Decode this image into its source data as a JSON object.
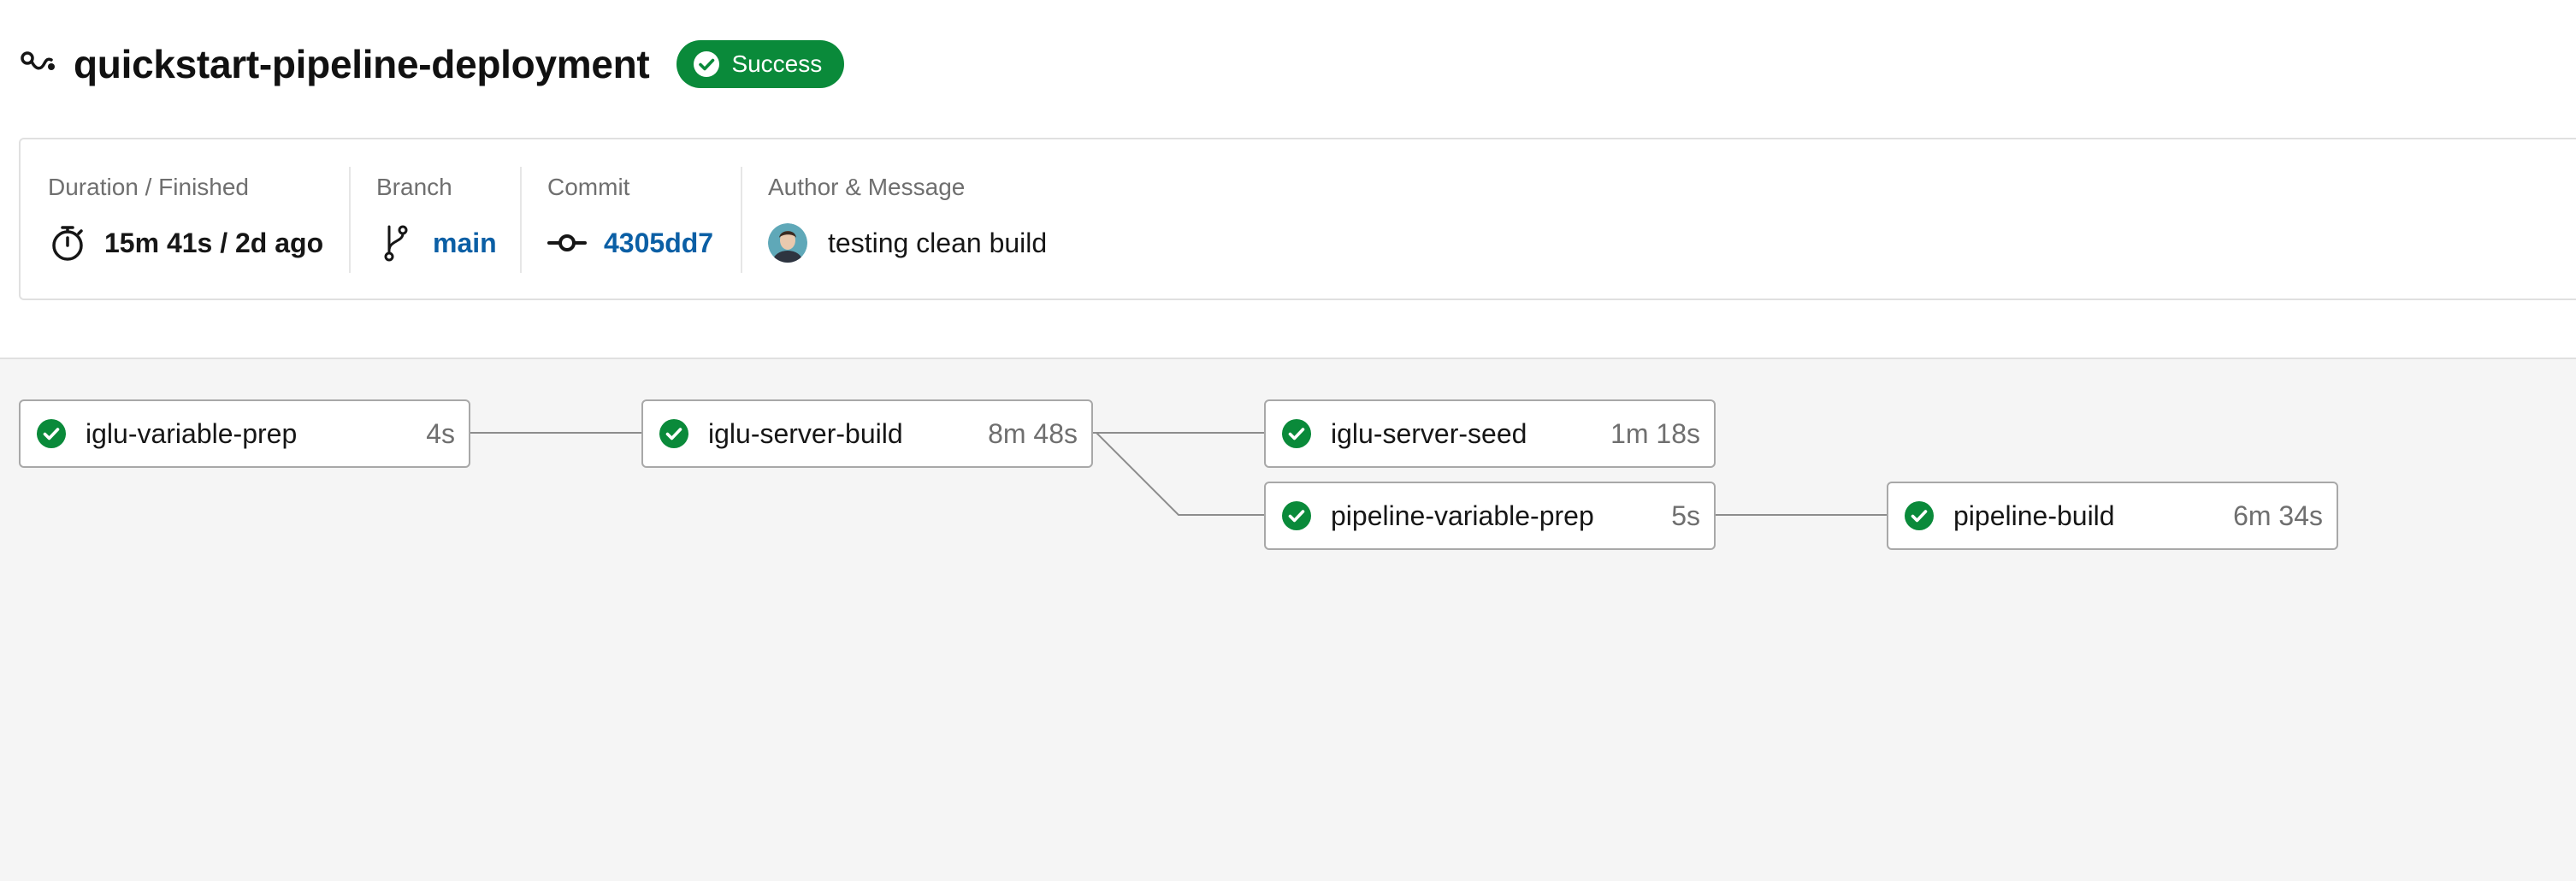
{
  "header": {
    "title": "quickstart-pipeline-deployment",
    "status": "Success",
    "status_color": "#0a8a3a"
  },
  "summary": {
    "duration": {
      "label": "Duration / Finished",
      "value": "15m 41s / 2d ago",
      "icon": "stopwatch-icon"
    },
    "branch": {
      "label": "Branch",
      "value": "main",
      "icon": "branch-icon"
    },
    "commit": {
      "label": "Commit",
      "value": "4305dd7",
      "icon": "commit-icon"
    },
    "author": {
      "label": "Author & Message",
      "message": "testing clean build",
      "icon": "avatar"
    }
  },
  "colors": {
    "link": "#0b5fa5",
    "success": "#0a8a3a",
    "graph_background": "#f5f5f5",
    "node_border": "#a8a8a8",
    "edge": "#8d8d8d"
  },
  "jobs": [
    {
      "name": "iglu-variable-prep",
      "duration": "4s",
      "status": "success"
    },
    {
      "name": "iglu-server-build",
      "duration": "8m 48s",
      "status": "success"
    },
    {
      "name": "iglu-server-seed",
      "duration": "1m 18s",
      "status": "success"
    },
    {
      "name": "pipeline-variable-prep",
      "duration": "5s",
      "status": "success"
    },
    {
      "name": "pipeline-build",
      "duration": "6m 34s",
      "status": "success"
    }
  ]
}
